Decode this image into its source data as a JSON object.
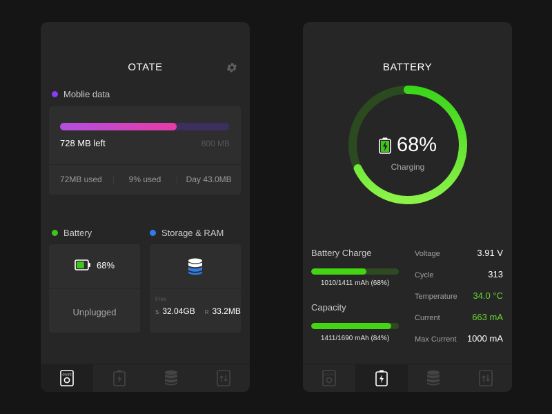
{
  "otate": {
    "title": "OTATE",
    "mobile_data": {
      "label": "Moblie data",
      "used_fraction": 0.69,
      "left_text": "728 MB left",
      "max_text": "800 MB",
      "stats": [
        {
          "text": "72MB used"
        },
        {
          "text": "9% used"
        },
        {
          "text": "Day  43.0MB"
        }
      ],
      "colors": {
        "dot": "#8a3cf0",
        "track": "#3c2f5e",
        "fill_start": "#b24fe0",
        "fill_end": "#e73ba6"
      }
    },
    "battery": {
      "label": "Battery",
      "percent_text": "68%",
      "level": 0.68,
      "status": "Unplugged",
      "dot_color": "#3ec61c"
    },
    "storage": {
      "label": "Storage & RAM",
      "free_label": "Free",
      "storage_prefix": "S",
      "storage_value": "32.04GB",
      "ram_prefix": "R",
      "ram_value": "33.2MB",
      "dot_color": "#2e7de8"
    },
    "nav_icons": [
      "otate-tab-icon",
      "battery-tab-icon",
      "database-tab-icon",
      "data-tab-icon"
    ],
    "nav_icon_text": "OTATE"
  },
  "battery_screen": {
    "title": "BATTERY",
    "gauge": {
      "percent_text": "68%",
      "level": 0.68,
      "status": "Charging",
      "colors": {
        "track": "#2b4a1f",
        "fill_start": "#3bd61a",
        "fill_end": "#8cf24a"
      }
    },
    "battery_charge": {
      "label": "Battery Charge",
      "fraction": 0.63,
      "text": "1010/1411 mAh (68%)"
    },
    "capacity": {
      "label": "Capacity",
      "fraction": 0.91,
      "text": "1411/1690 mAh  (84%)"
    },
    "specs": [
      {
        "key": "Voltage",
        "value": "3.91 V",
        "highlight": false
      },
      {
        "key": "Cycle",
        "value": "313",
        "highlight": false
      },
      {
        "key": "Temperature",
        "value": "34.0 °C",
        "highlight": true
      },
      {
        "key": "Current",
        "value": "663 mA",
        "highlight": true
      },
      {
        "key": "Max Current",
        "value": "1000 mA",
        "highlight": false
      }
    ],
    "nav_icons": [
      "otate-tab-icon",
      "battery-tab-icon",
      "database-tab-icon",
      "data-tab-icon"
    ],
    "active_tab": 1
  }
}
